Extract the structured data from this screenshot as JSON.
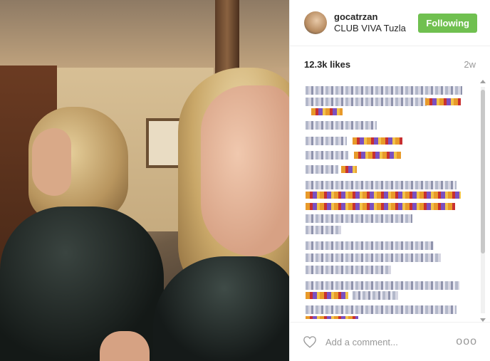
{
  "post": {
    "username": "gocatrzan",
    "location": "CLUB VIVA Tuzla",
    "follow_label": "Following",
    "likes": "12.3k likes",
    "time_ago": "2w",
    "comment_placeholder": "Add a comment...",
    "more_label": "ooo"
  },
  "colors": {
    "follow_button": "#70c050",
    "text_primary": "#262626",
    "text_muted": "#999999"
  },
  "icons": {
    "like": "heart-outline-icon",
    "more": "more-options-icon"
  }
}
